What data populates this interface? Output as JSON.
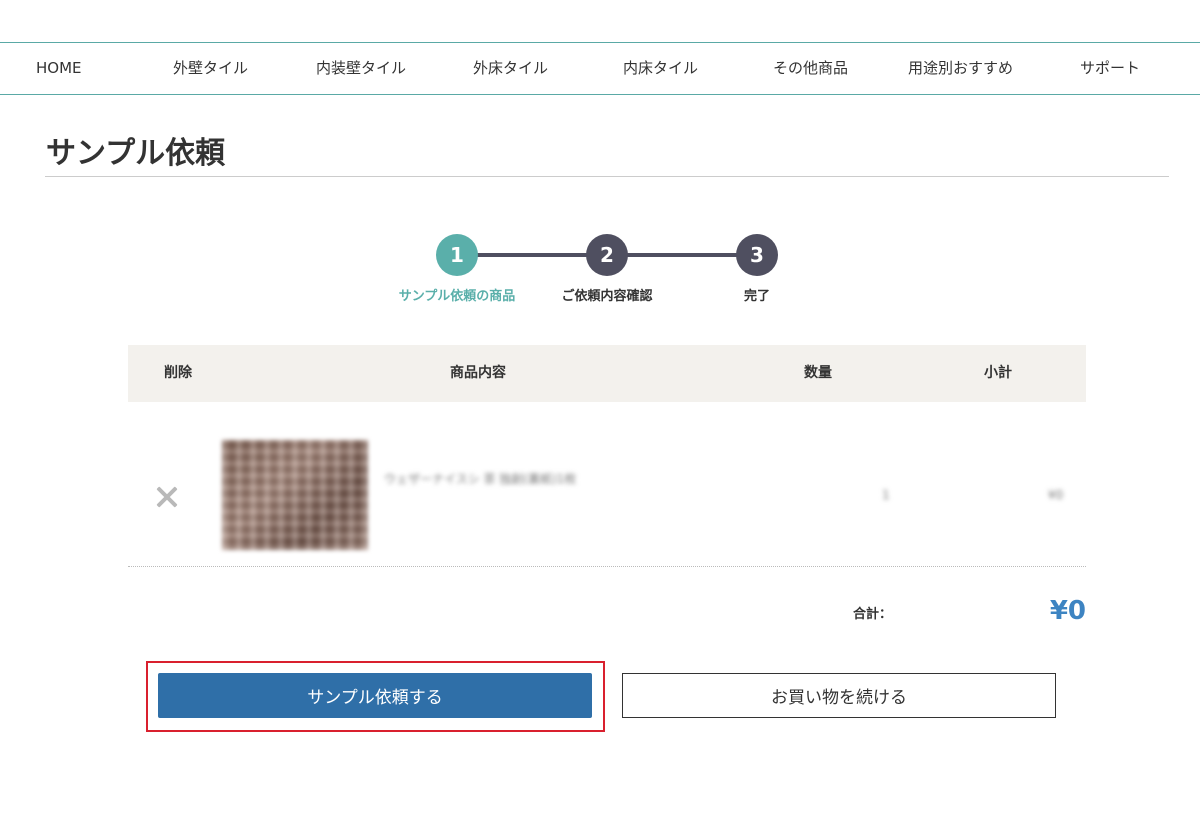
{
  "nav": {
    "items": [
      "HOME",
      "外壁タイル",
      "内装壁タイル",
      "外床タイル",
      "内床タイル",
      "その他商品",
      "用途別おすすめ",
      "サポート"
    ]
  },
  "page": {
    "title": "サンプル依頼"
  },
  "stepper": {
    "steps": [
      {
        "number": "1",
        "label": "サンプル依頼の商品",
        "active": true
      },
      {
        "number": "2",
        "label": "ご依頼内容確認",
        "active": false
      },
      {
        "number": "3",
        "label": "完了",
        "active": false
      }
    ],
    "colors": {
      "active": "#5aafaa",
      "inactive": "#4f4f60",
      "active_label": "#5aafaa",
      "inactive_label": "#333333"
    }
  },
  "table": {
    "headers": {
      "delete": "削除",
      "product": "商品内容",
      "quantity": "数量",
      "subtotal": "小計"
    },
    "rows": [
      {
        "name": "ウェザーナイスシ 茶 独創(裏紙)1枚",
        "quantity": "1",
        "subtotal": "¥0"
      }
    ]
  },
  "total": {
    "label": "合計：",
    "value": "¥0"
  },
  "actions": {
    "submit_label": "サンプル依頼する",
    "continue_label": "お買い物を続ける"
  },
  "colors": {
    "accent_teal": "#5aa9a6",
    "primary_blue": "#2f6fa8",
    "total_blue": "#3d84c2",
    "highlight_red": "#d9202e"
  }
}
